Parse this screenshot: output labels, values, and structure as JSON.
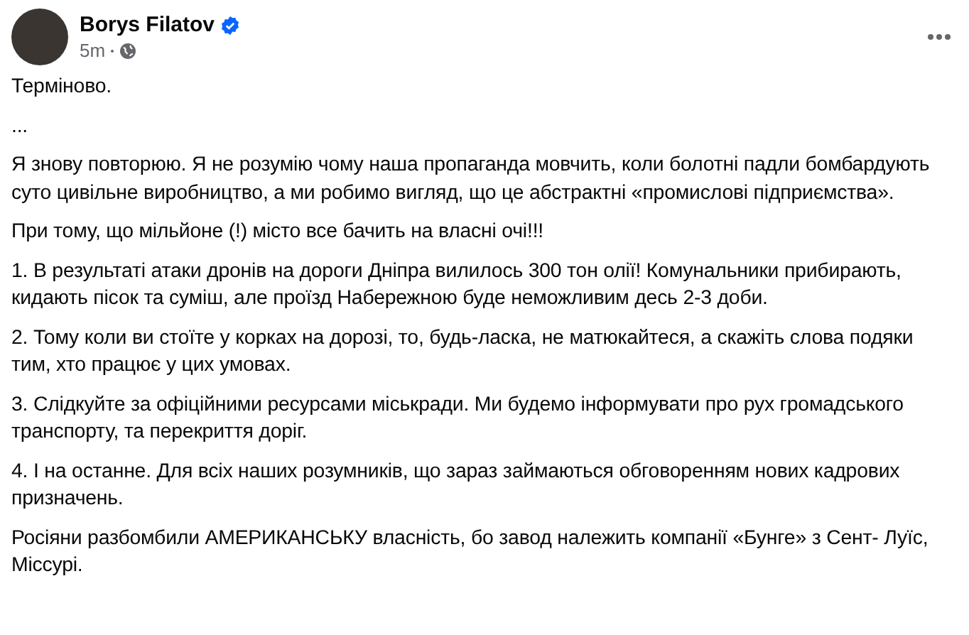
{
  "post": {
    "author": "Borys Filatov",
    "verified": true,
    "time": "5m",
    "paragraphs": [
      "Терміново.",
      "...",
      "Я знову повторюю. Я не розумію чому наша пропаганда мовчить, коли болотні падли бомбардують суто цивільне виробництво, а ми робимо вигляд, що це абстрактні «промислові підприємства».",
      "При тому, що мільйоне (!) місто все бачить на власні очі!!!",
      "1. В результаті атаки дронів на дороги Дніпра вилилось 300 тон олії! Комунальники прибирають, кидають пісок та суміш, але проїзд Набережною буде неможливим десь 2-3 доби.",
      "2. Тому коли ви стоїте у корках на дорозі, то, будь-ласка, не матюкайтеся, а скажіть слова подяки тим, хто працює у цих умовах.",
      "3. Слідкуйте за офіційними ресурсами міськради. Ми будемо інформувати про рух громадського транспорту, та перекриття доріг.",
      "4. І на останне. Для всіх наших розумників, що зараз займаються обговоренням нових кадрових призначень.",
      "Росіяни разбомбили АМЕРИКАНСЬКУ власність, бо завод належить компанії «Бунге» з Сент- Луїс, Міссурі."
    ]
  }
}
